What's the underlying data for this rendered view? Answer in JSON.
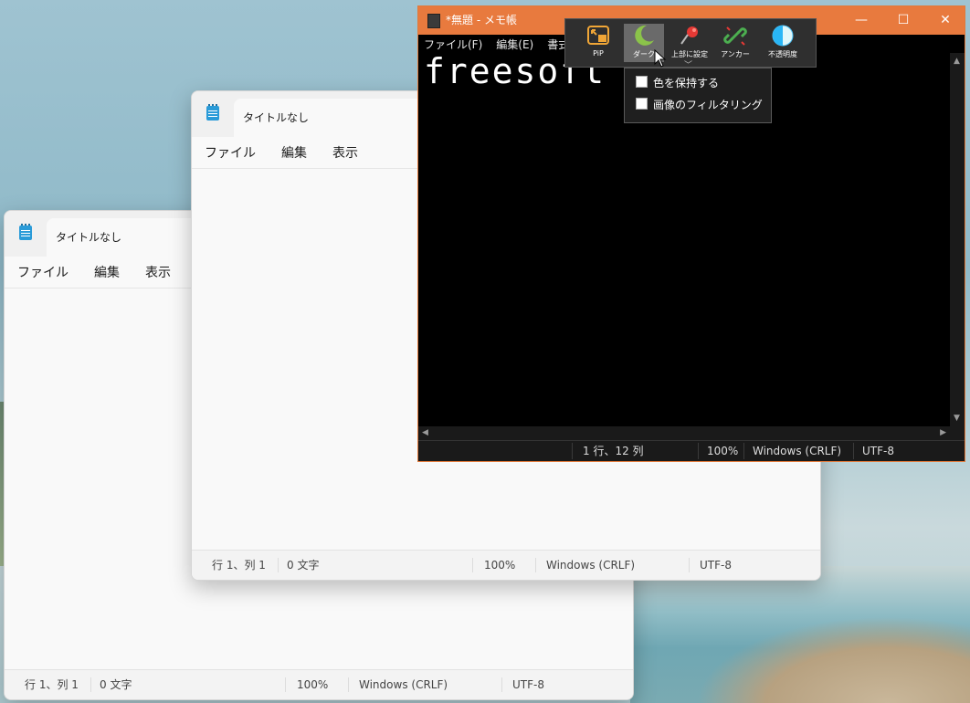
{
  "back_window": {
    "tab_title": "タイトルなし",
    "menu": [
      "ファイル",
      "編集",
      "表示"
    ],
    "status": {
      "position": "行 1、列 1",
      "chars": "0 文字",
      "zoom": "100%",
      "eol": "Windows (CRLF)",
      "encoding": "UTF-8"
    }
  },
  "mid_window": {
    "tab_title": "タイトルなし",
    "menu": [
      "ファイル",
      "編集",
      "表示"
    ],
    "status": {
      "position": "行 1、列 1",
      "chars": "0 文字",
      "zoom": "100%",
      "eol": "Windows (CRLF)",
      "encoding": "UTF-8"
    }
  },
  "classic_window": {
    "title": "*無題 - メモ帳",
    "menu": [
      "ファイル(F)",
      "編集(E)",
      "書式(O)"
    ],
    "text": "freesoft",
    "status": {
      "position": "1 行、12 列",
      "zoom": "100%",
      "eol": "Windows (CRLF)",
      "encoding": "UTF-8"
    },
    "title_color": "#e87a3e"
  },
  "toolbar": {
    "buttons": [
      {
        "label": "PiP",
        "icon": "pip-icon"
      },
      {
        "label": "ダーク",
        "icon": "moon-icon"
      },
      {
        "label": "上部に設定",
        "icon": "pin-icon"
      },
      {
        "label": "アンカー",
        "icon": "link-icon"
      },
      {
        "label": "不透明度",
        "icon": "opacity-icon"
      }
    ]
  },
  "dark_dropdown": {
    "items": [
      "色を保持する",
      "画像のフィルタリング"
    ]
  }
}
